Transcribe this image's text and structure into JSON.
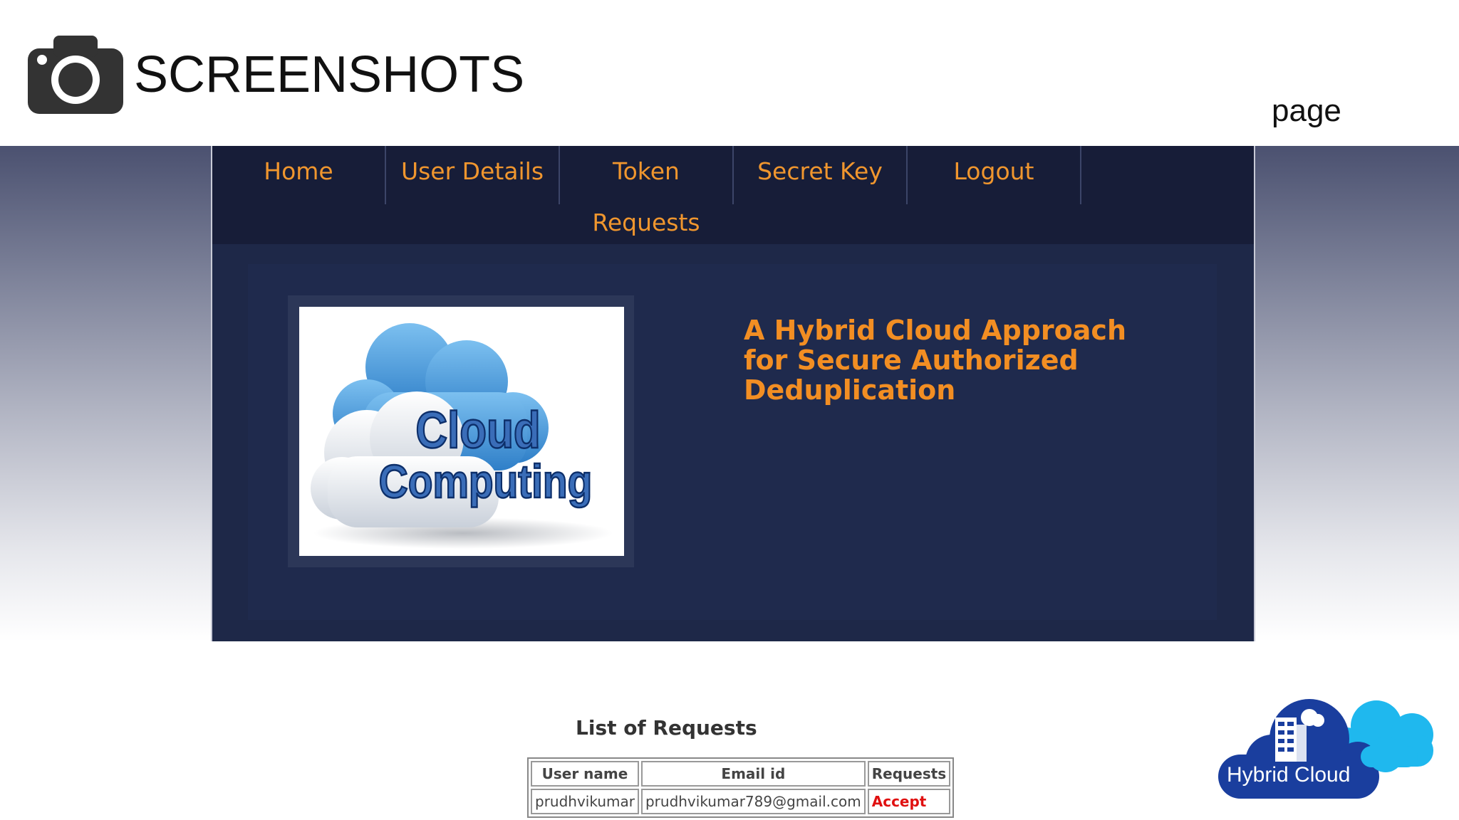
{
  "slide": {
    "title": "SCREENSHOTS",
    "corner_text": "page"
  },
  "nav": {
    "items": [
      {
        "label": "Home"
      },
      {
        "label": "User Details"
      },
      {
        "label": "Token Requests"
      },
      {
        "label": "Secret Key"
      },
      {
        "label": "Logout"
      }
    ],
    "text_color": "#f0962e",
    "background": "#171d38"
  },
  "hero": {
    "image_text_line1": "Cloud",
    "image_text_line2": "Computing",
    "title": "A Hybrid Cloud Approach for Secure Authorized Deduplication",
    "title_color": "#f28e23"
  },
  "requests": {
    "heading": "List of Requests",
    "columns": [
      "User name",
      "Email id",
      "Requests"
    ],
    "rows": [
      {
        "user": "prudhvikumar",
        "email": "prudhvikumar789@gmail.com",
        "action": "Accept"
      }
    ]
  },
  "logo": {
    "text": "Hybrid Cloud",
    "icon": "hybrid-cloud-icon"
  },
  "icons": {
    "camera": "camera-icon"
  }
}
